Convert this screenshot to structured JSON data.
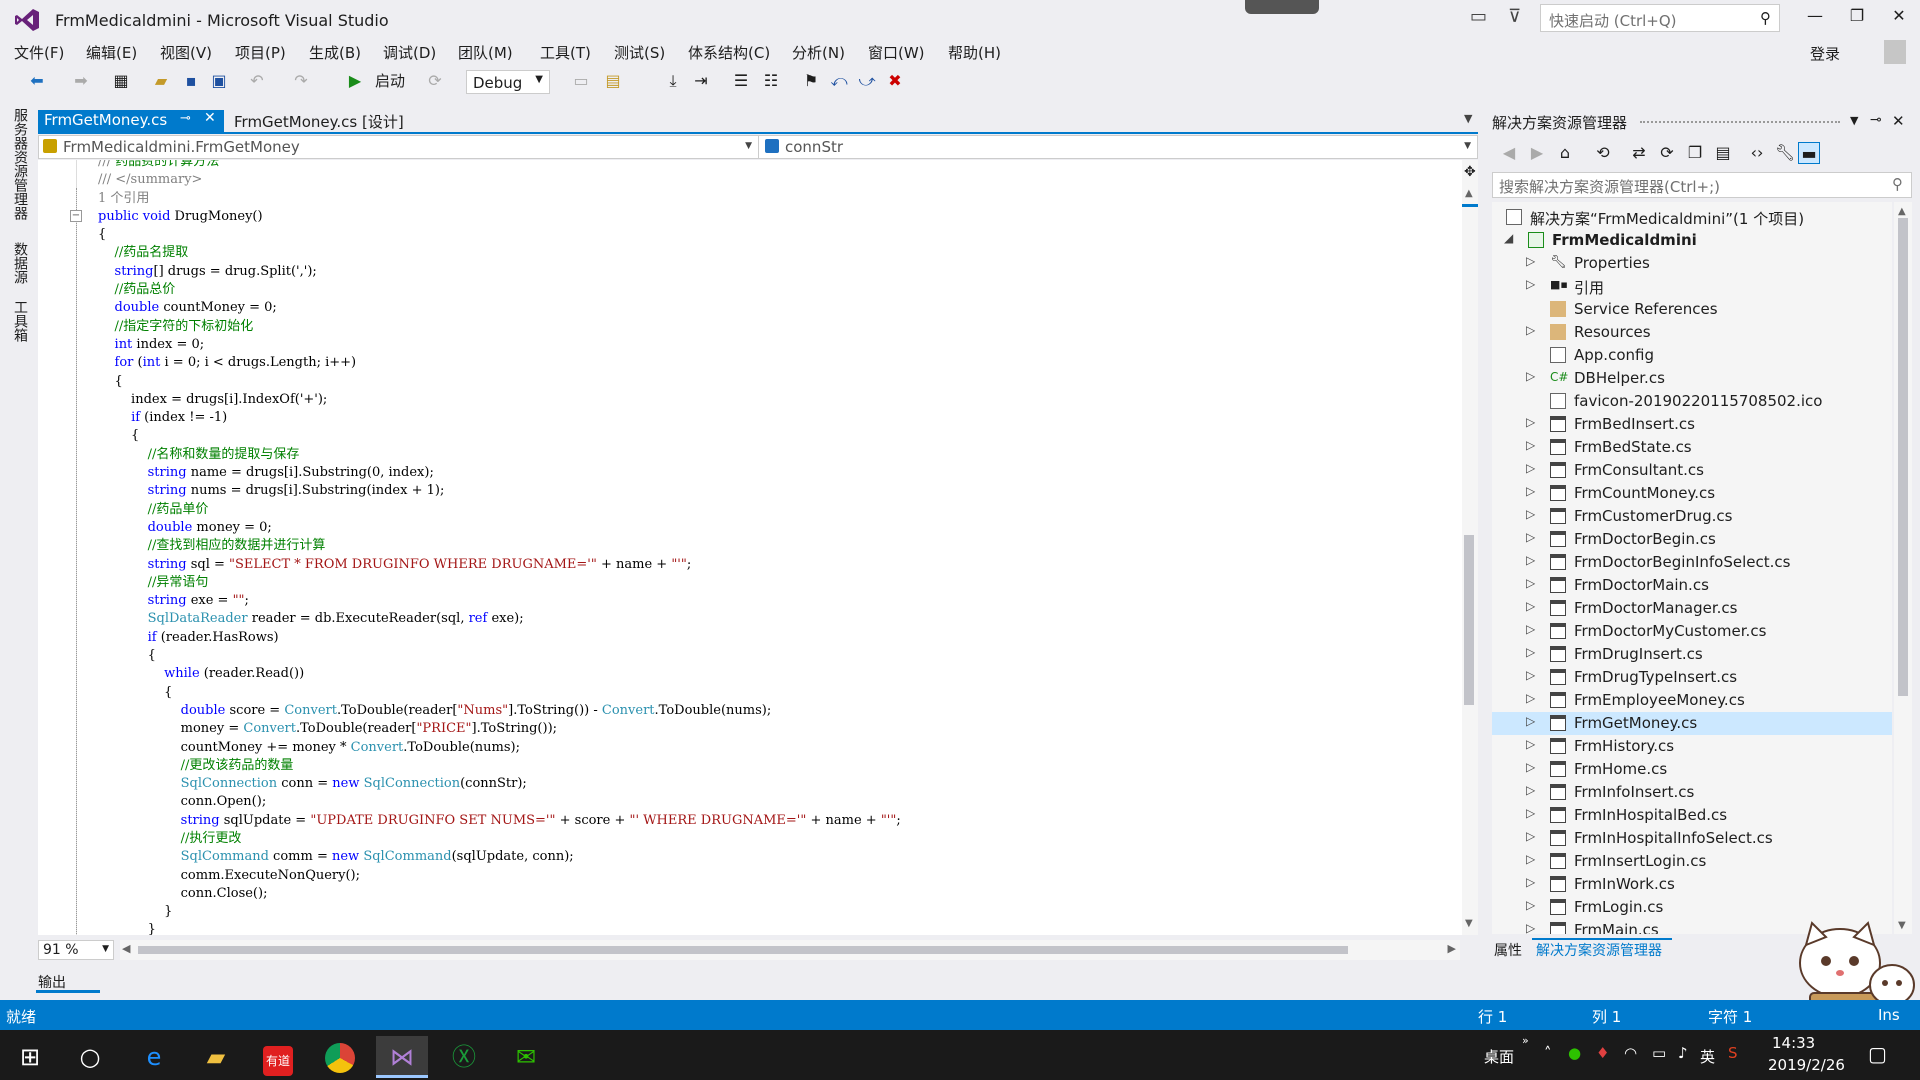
{
  "window": {
    "title": "FrmMedicaldmini - Microsoft Visual Studio",
    "quick_launch_placeholder": "快速启动 (Ctrl+Q)",
    "login": "登录"
  },
  "menu": [
    "文件(F)",
    "编辑(E)",
    "视图(V)",
    "项目(P)",
    "生成(B)",
    "调试(D)",
    "团队(M)",
    "工具(T)",
    "测试(S)",
    "体系结构(C)",
    "分析(N)",
    "窗口(W)",
    "帮助(H)"
  ],
  "toolbar": {
    "start_label": "启动",
    "config": "Debug"
  },
  "left_tabs": [
    "服务器资源管理器",
    "数据源",
    "工具箱"
  ],
  "tabs": {
    "active": "FrmGetMoney.cs",
    "inactive": "FrmGetMoney.cs [设计]"
  },
  "navbar": {
    "class": "FrmMedicaldmini.FrmGetMoney",
    "member": "connStr"
  },
  "editor": {
    "zoom": "91 %",
    "refs": "1 个引用"
  },
  "output_tab": "输出",
  "solution_explorer": {
    "title": "解决方案资源管理器",
    "search_placeholder": "搜索解决方案资源管理器(Ctrl+;)",
    "solution": "解决方案“FrmMedicaldmini”(1 个项目)",
    "project": "FrmMedicaldmini",
    "items": [
      {
        "label": "Properties",
        "icon": "wrench-icon",
        "expandable": true
      },
      {
        "label": "引用",
        "icon": "references-icon",
        "expandable": true
      },
      {
        "label": "Service References",
        "icon": "folder-icon",
        "expandable": false
      },
      {
        "label": "Resources",
        "icon": "folder-icon",
        "expandable": true
      },
      {
        "label": "App.config",
        "icon": "config-icon",
        "expandable": false
      },
      {
        "label": "DBHelper.cs",
        "icon": "csharp-class-icon",
        "expandable": true
      },
      {
        "label": "favicon-20190220115708502.ico",
        "icon": "ico-file-icon",
        "expandable": false
      },
      {
        "label": "FrmBedInsert.cs",
        "icon": "form-icon",
        "expandable": true
      },
      {
        "label": "FrmBedState.cs",
        "icon": "form-icon",
        "expandable": true
      },
      {
        "label": "FrmConsultant.cs",
        "icon": "form-icon",
        "expandable": true
      },
      {
        "label": "FrmCountMoney.cs",
        "icon": "form-icon",
        "expandable": true
      },
      {
        "label": "FrmCustomerDrug.cs",
        "icon": "form-icon",
        "expandable": true
      },
      {
        "label": "FrmDoctorBegin.cs",
        "icon": "form-icon",
        "expandable": true
      },
      {
        "label": "FrmDoctorBeginInfoSelect.cs",
        "icon": "form-icon",
        "expandable": true
      },
      {
        "label": "FrmDoctorMain.cs",
        "icon": "form-icon",
        "expandable": true
      },
      {
        "label": "FrmDoctorManager.cs",
        "icon": "form-icon",
        "expandable": true
      },
      {
        "label": "FrmDoctorMyCustomer.cs",
        "icon": "form-icon",
        "expandable": true
      },
      {
        "label": "FrmDrugInsert.cs",
        "icon": "form-icon",
        "expandable": true
      },
      {
        "label": "FrmDrugTypeInsert.cs",
        "icon": "form-icon",
        "expandable": true
      },
      {
        "label": "FrmEmployeeMoney.cs",
        "icon": "form-icon",
        "expandable": true
      },
      {
        "label": "FrmGetMoney.cs",
        "icon": "form-icon",
        "expandable": true,
        "selected": true
      },
      {
        "label": "FrmHistory.cs",
        "icon": "form-icon",
        "expandable": true
      },
      {
        "label": "FrmHome.cs",
        "icon": "form-icon",
        "expandable": true
      },
      {
        "label": "FrmInfoInsert.cs",
        "icon": "form-icon",
        "expandable": true
      },
      {
        "label": "FrmInHospitalBed.cs",
        "icon": "form-icon",
        "expandable": true
      },
      {
        "label": "FrmInHospitalInfoSelect.cs",
        "icon": "form-icon",
        "expandable": true
      },
      {
        "label": "FrmInsertLogin.cs",
        "icon": "form-icon",
        "expandable": true
      },
      {
        "label": "FrmInWork.cs",
        "icon": "form-icon",
        "expandable": true
      },
      {
        "label": "FrmLogin.cs",
        "icon": "form-icon",
        "expandable": true
      },
      {
        "label": "FrmMain.cs",
        "icon": "form-icon",
        "expandable": true
      }
    ],
    "bottom_tabs": [
      "属性",
      "解决方案资源管理器"
    ]
  },
  "status": {
    "ready": "就绪",
    "line": "行 1",
    "col": "列 1",
    "char": "字符 1",
    "ins": "Ins"
  },
  "taskbar": {
    "desktop": "桌面",
    "ime": "英",
    "time": "14:33",
    "date": "2019/2/26"
  },
  "colors": {
    "accent": "#007acc",
    "selection": "#cce8ff",
    "keyword": "#0000ff",
    "type": "#2b91af",
    "comment": "#008000",
    "string": "#a31515"
  }
}
